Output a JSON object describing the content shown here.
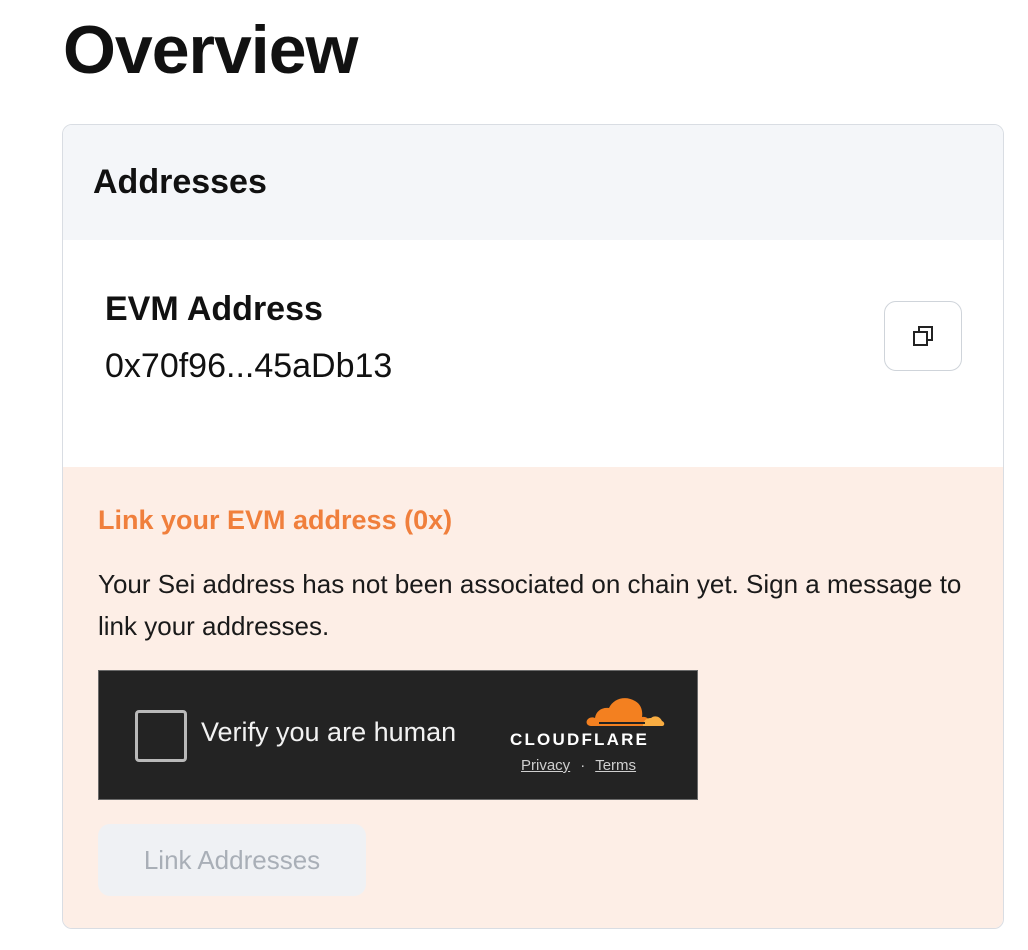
{
  "page": {
    "title": "Overview"
  },
  "addresses_card": {
    "header": "Addresses",
    "evm": {
      "label": "EVM Address",
      "value": "0x70f96...45aDb13",
      "copy_icon": "copy-icon"
    }
  },
  "link_notice": {
    "title": "Link your EVM address (0x)",
    "text": "Your Sei address has not been associated on chain yet. Sign a message to link your addresses.",
    "captcha": {
      "label": "Verify you are human",
      "brand": "CLOUDFLARE",
      "privacy": "Privacy",
      "separator": "·",
      "terms": "Terms",
      "checked": false
    },
    "button_label": "Link Addresses",
    "button_disabled": true
  },
  "colors": {
    "accent_orange": "#f07f3c",
    "notice_bg": "#fdeee6",
    "header_bg": "#f4f6f9",
    "captcha_bg": "#232323",
    "cloudflare_orange": "#f38020"
  }
}
